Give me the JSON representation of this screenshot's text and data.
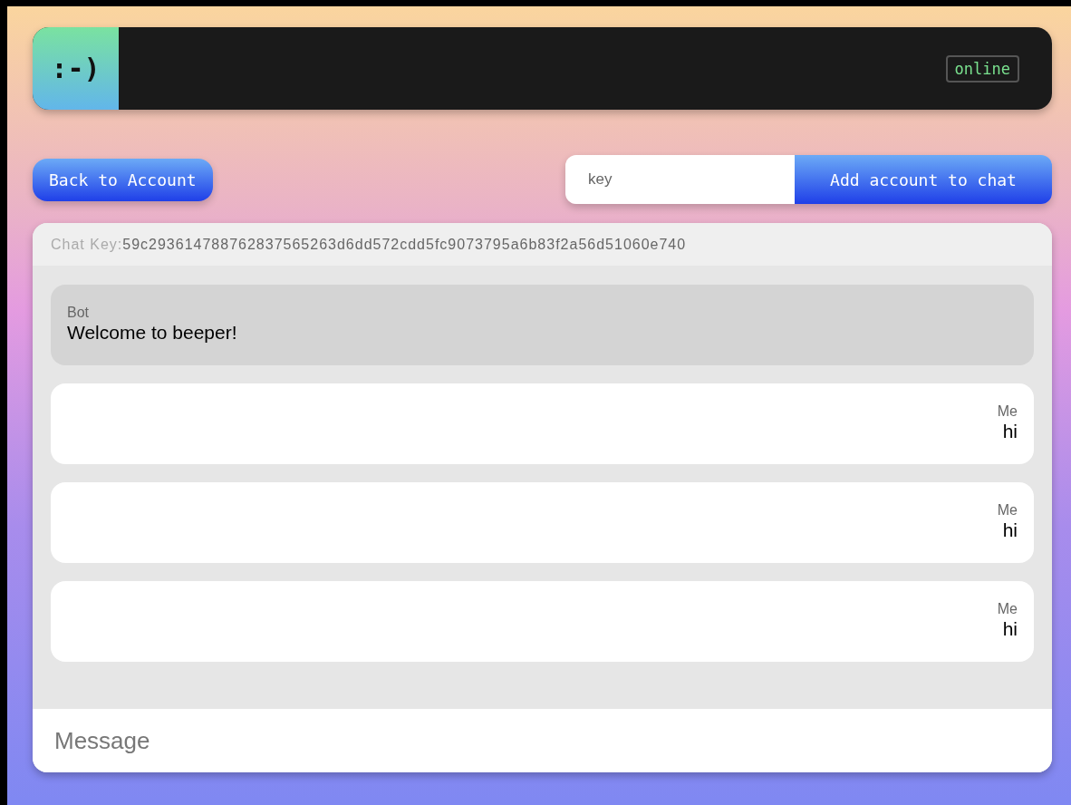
{
  "header": {
    "logo": ":-)",
    "status": "online"
  },
  "actions": {
    "back_button": "Back to Account",
    "key_field": {
      "placeholder": "key"
    },
    "add_button": "Add account to chat"
  },
  "chat": {
    "key_label": "Chat Key:",
    "key_value": "59c293614788762837565263d6dd572cdd5fc9073795a6b83f2a56d51060e740",
    "messages": [
      {
        "kind": "bot",
        "sender": "Bot",
        "text": "Welcome to beeper!"
      },
      {
        "kind": "self",
        "sender": "Me",
        "text": "hi"
      },
      {
        "kind": "self",
        "sender": "Me",
        "text": "hi"
      },
      {
        "kind": "self",
        "sender": "Me",
        "text": "hi"
      }
    ],
    "composer": {
      "placeholder": "Message"
    }
  }
}
